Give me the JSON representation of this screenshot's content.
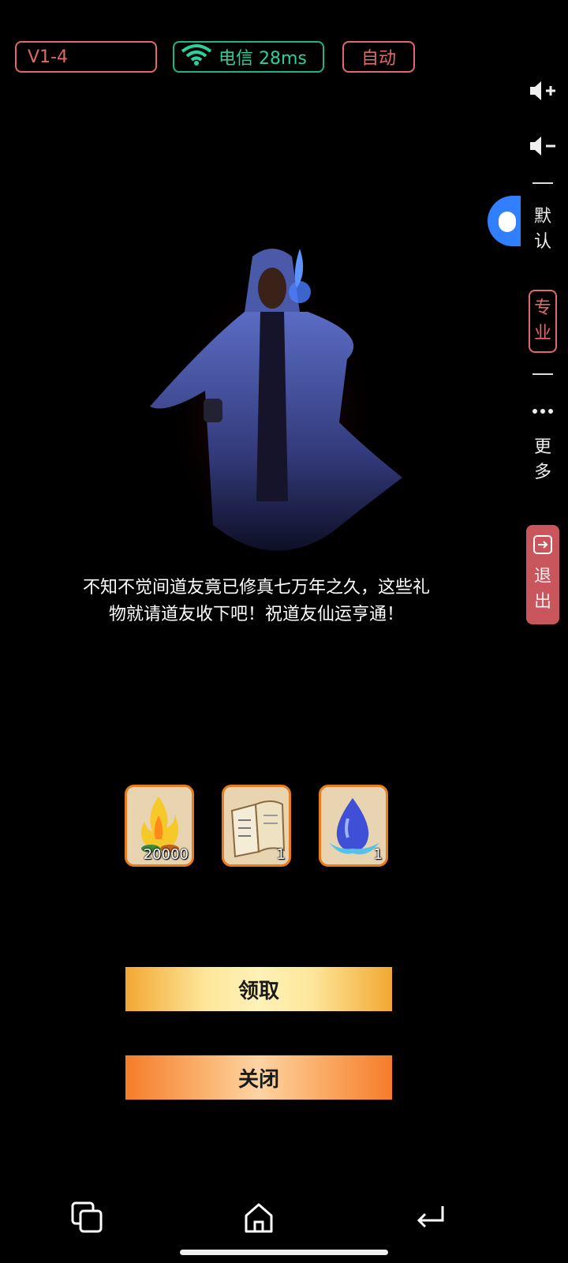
{
  "status": {
    "version": "V1-4",
    "network": "电信 28ms",
    "auto": "自动"
  },
  "side_panel": {
    "volume_up_icon": "volume-up-icon",
    "volume_down_icon": "volume-down-icon",
    "default_label": [
      "默",
      "认"
    ],
    "pro_label": [
      "专",
      "业"
    ],
    "more_label": [
      "更",
      "多"
    ],
    "exit_label": [
      "退",
      "出"
    ]
  },
  "dialog": {
    "line1": "不知不觉间道友竟已修真七万年之久，这些礼",
    "line2": "物就请道友收下吧！祝道友仙运亨通！"
  },
  "rewards": [
    {
      "icon": "fire-coins-icon",
      "count": "20000"
    },
    {
      "icon": "book-icon",
      "count": "1"
    },
    {
      "icon": "water-drop-icon",
      "count": "1"
    }
  ],
  "buttons": {
    "claim": "领取",
    "close": "关闭"
  },
  "colors": {
    "accent_red": "#e06a6a",
    "accent_green": "#1fb48a",
    "exit_bg": "#c9555d",
    "item_border": "#e67d1f"
  }
}
